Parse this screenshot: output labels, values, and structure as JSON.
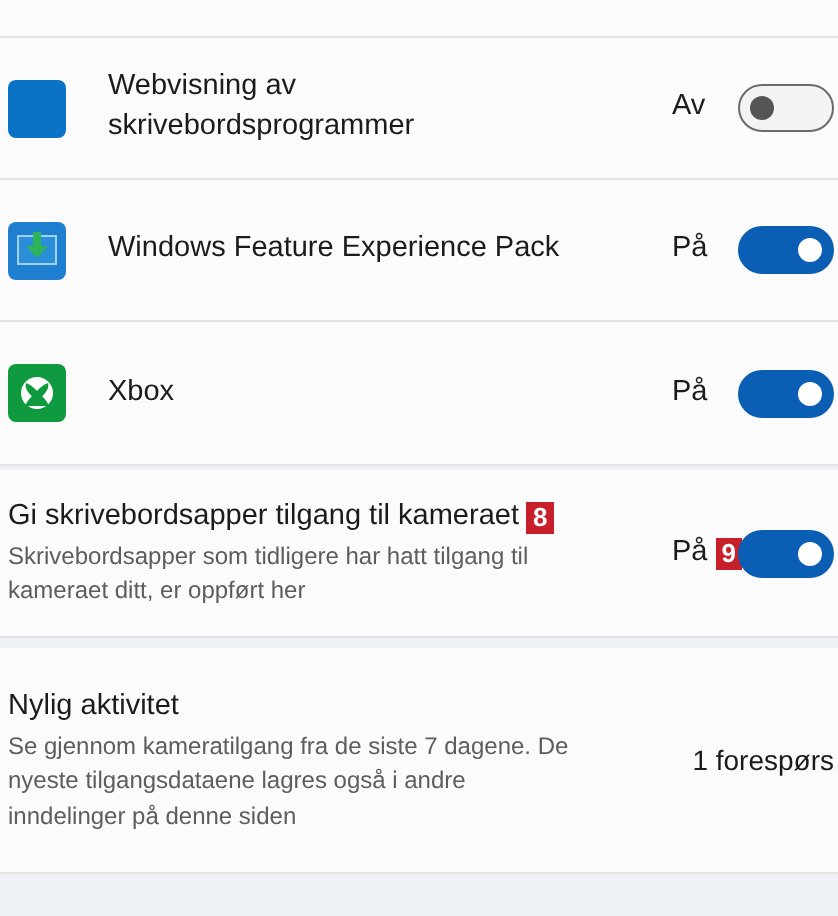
{
  "apps": [
    {
      "kind": "blank",
      "name": "Webvisning av skrivebordsprogrammer",
      "status": "Av",
      "on": false
    },
    {
      "kind": "download",
      "name": "Windows Feature Experience Pack",
      "status": "På",
      "on": true
    },
    {
      "kind": "xbox",
      "name": "Xbox",
      "status": "På",
      "on": true
    }
  ],
  "desktop_access": {
    "title": "Gi skrivebordsapper tilgang til kameraet",
    "title_marker": "8",
    "description": "Skrivebordsapper som tidligere har hatt tilgang til kameraet ditt, er oppført her",
    "status": "På",
    "status_marker": "9",
    "on": true
  },
  "recent_activity": {
    "title": "Nylig aktivitet",
    "description": "Se gjennom kameratilgang fra de siste 7 dagene. De nyeste tilgangsdataene lagres også i andre inndelinger på denne siden",
    "value": "1 forespørs"
  }
}
